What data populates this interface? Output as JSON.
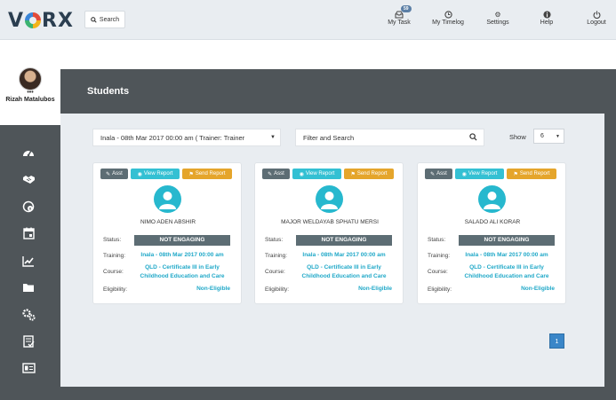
{
  "brand": {
    "logo_text_a": "V",
    "logo_text_b": "RX"
  },
  "topbar": {
    "search_label": "Search",
    "nav": [
      {
        "label": "My Task",
        "icon": "inbox-icon",
        "badge": "59"
      },
      {
        "label": "My Timelog",
        "icon": "clock-icon"
      },
      {
        "label": "Settings",
        "icon": "gear-icon"
      },
      {
        "label": "Help",
        "icon": "info-icon"
      },
      {
        "label": "Logout",
        "icon": "power-icon"
      }
    ]
  },
  "profile": {
    "name": "Rizah Matalubos",
    "dots": "•••"
  },
  "sidebar": {
    "icons": [
      "dashboard-icon",
      "handshake-icon",
      "info-settings-icon",
      "calendar-icon",
      "chart-icon",
      "folder-icon",
      "gears-icon",
      "checklist-icon",
      "id-card-icon"
    ]
  },
  "page": {
    "title": "Students"
  },
  "filters": {
    "training_select": "Inala - 08th Mar 2017 00:00 am ( Trainer: Trainer",
    "search_placeholder": "Filter and Search",
    "show_label": "Show",
    "show_value": "6"
  },
  "card_labels": {
    "asst": "Asst",
    "view": "View Report",
    "send": "Send Report",
    "status": "Status:",
    "training": "Training:",
    "course": "Course:",
    "eligibility": "Eligibility:"
  },
  "students": [
    {
      "name": "NIMO ADEN ABSHIR",
      "status": "NOT ENGAGING",
      "training": "Inala - 08th Mar 2017 00:00 am",
      "course_l1": "QLD - Certificate III in Early",
      "course_l2": "Childhood Education and Care",
      "eligibility": "Non-Eligible"
    },
    {
      "name": "MAJOR WELDAYAB SPHATU MERSI",
      "status": "NOT ENGAGING",
      "training": "Inala - 08th Mar 2017 00:00 am",
      "course_l1": "QLD - Certificate III in Early",
      "course_l2": "Childhood Education and Care",
      "eligibility": "Non-Eligible"
    },
    {
      "name": "SALADO ALI KORAR",
      "status": "NOT ENGAGING",
      "training": "Inala - 08th Mar 2017 00:00 am",
      "course_l1": "QLD - Certificate III in Early",
      "course_l2": "Childhood Education and Care",
      "eligibility": "Non-Eligible"
    }
  ],
  "pagination": {
    "current": "1"
  },
  "colors": {
    "accent": "#34c0d3",
    "send": "#e5a52b",
    "dark": "#4f5559",
    "status": "#5d6d74"
  }
}
